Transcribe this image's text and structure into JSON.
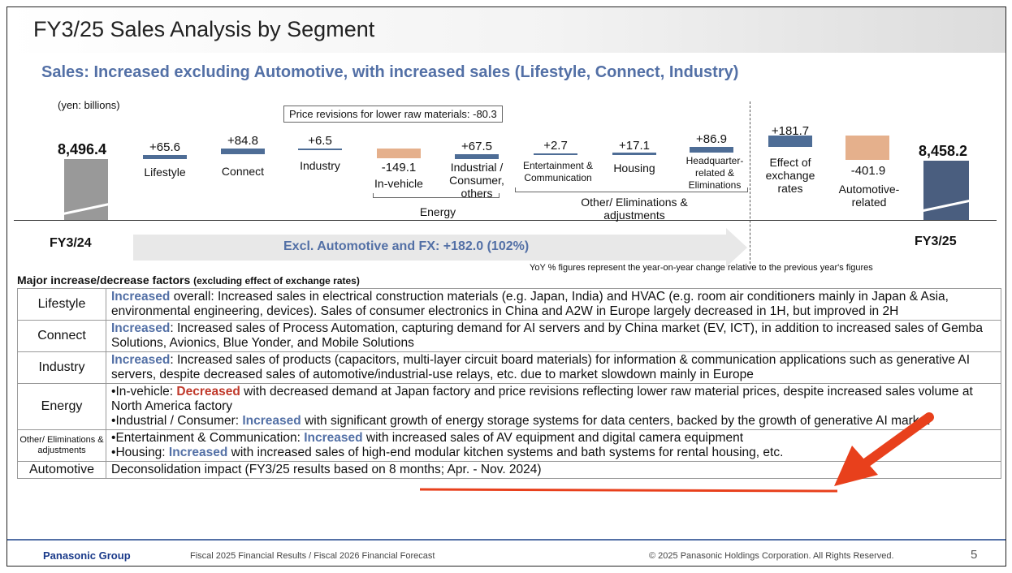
{
  "header": {
    "title": "FY3/25 Sales Analysis by Segment",
    "subtitle": "Sales: Increased excluding Automotive, with increased sales (Lifestyle, Connect, Industry)"
  },
  "chart": {
    "unit_label": "(yen: billions)",
    "price_note": "Price revisions for lower raw materials: -80.3",
    "start": {
      "value": "8,496.4",
      "period": "FY3/24"
    },
    "end": {
      "value": "8,458.2",
      "period": "FY3/25"
    },
    "steps": [
      {
        "label": "Lifestyle",
        "value": "+65.6"
      },
      {
        "label": "Connect",
        "value": "+84.8"
      },
      {
        "label": "Industry",
        "value": "+6.5"
      },
      {
        "label": "In-vehicle",
        "value": "-149.1"
      },
      {
        "label": "Industrial / Consumer, others",
        "value": "+67.5"
      },
      {
        "label": "Entertainment & Communication",
        "value": "+2.7"
      },
      {
        "label": "Housing",
        "value": "+17.1"
      },
      {
        "label": "Headquarter-related & Eliminations",
        "value": "+86.9"
      },
      {
        "label": "Effect of exchange rates",
        "value": "+181.7"
      },
      {
        "label": "Automotive-related",
        "value": "-401.9"
      }
    ],
    "group_energy": "Energy",
    "group_other": "Other/ Eliminations & adjustments",
    "excl_arrow": "Excl. Automotive and FX: +182.0 (102%)",
    "yoy_note": "YoY % figures represent the year-on-year change relative to the previous year's figures"
  },
  "factors": {
    "heading": "Major increase/decrease factors",
    "heading_note": "(excluding effect of exchange rates)",
    "rows": [
      {
        "segment": "Lifestyle",
        "keyword": "Increased",
        "text": " overall: Increased sales in electrical construction materials (e.g. Japan, India) and HVAC (e.g. room air conditioners mainly in Japan & Asia, environmental engineering, devices). Sales of consumer electronics in China and A2W in Europe largely decreased in 1H, but improved in 2H"
      },
      {
        "segment": "Connect",
        "keyword": "Increased",
        "text": ": Increased sales of Process Automation, capturing demand for AI servers and by China market (EV, ICT), in addition to increased sales of Gemba Solutions, Avionics, Blue Yonder, and Mobile Solutions"
      },
      {
        "segment": "Industry",
        "keyword": "Increased",
        "text": ": Increased sales of products (capacitors, multi-layer circuit board materials) for information & communication applications such as generative AI servers, despite decreased sales of automotive/industrial-use relays, etc. due to market slowdown mainly in Europe"
      },
      {
        "segment": "Energy",
        "b1_pre": "In-vehicle: ",
        "b1_kw": "Decreased",
        "b1_text": " with decreased demand at Japan factory and price revisions reflecting lower raw material prices, despite increased sales volume at North America factory",
        "b2_pre": "Industrial / Consumer: ",
        "b2_kw": "Increased",
        "b2_text": " with significant growth of energy storage systems for data centers, backed by the growth of generative AI market"
      },
      {
        "segment": "Other/ Eliminations & adjustments",
        "b1_pre": "Entertainment & Communication: ",
        "b1_kw": "Increased",
        "b1_text": " with increased sales of AV equipment and digital camera equipment",
        "b2_pre": "Housing: ",
        "b2_kw": "Increased",
        "b2_text": " with increased sales of high-end modular kitchen systems and bath systems for rental housing, etc."
      },
      {
        "segment": "Automotive",
        "text": "Deconsolidation impact (FY3/25 results based on 8 months; Apr. - Nov. 2024)"
      }
    ]
  },
  "footer": {
    "brand": "Panasonic Group",
    "doc": "Fiscal 2025 Financial Results / Fiscal 2026 Financial Forecast",
    "copyright": "© 2025 Panasonic Holdings Corporation. All Rights Reserved.",
    "page": "5"
  },
  "colors": {
    "accent": "#5370a6",
    "decrease": "#c0392b",
    "annotation": "#e8401c"
  }
}
